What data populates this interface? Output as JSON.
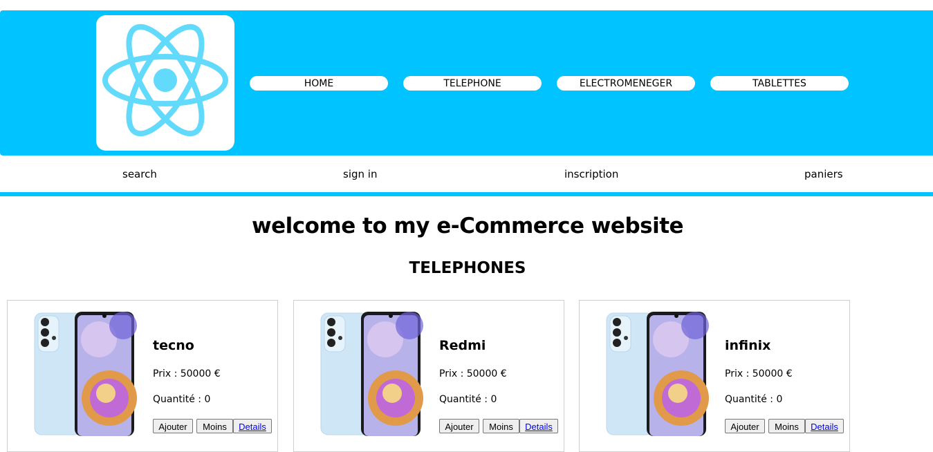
{
  "header": {
    "logo": "react-logo",
    "accent_color": "#00c3ff",
    "nav": [
      "HOME",
      "TELEPHONE",
      "ELECTROMENEGER",
      "TABLETTES"
    ]
  },
  "subnav": [
    "search",
    "sign in",
    "inscription",
    "paniers"
  ],
  "main": {
    "title": "welcome to my e-Commerce website",
    "section_title": "TELEPHONES"
  },
  "products": [
    {
      "name": "tecno",
      "price": "Prix : 50000 €",
      "quantity": "Quantité : 0",
      "add_label": "Ajouter",
      "less_label": "Moins",
      "details_label": "Details"
    },
    {
      "name": "Redmi",
      "price": "Prix : 50000 €",
      "quantity": "Quantité : 0",
      "add_label": "Ajouter",
      "less_label": "Moins",
      "details_label": "Details"
    },
    {
      "name": "infinix",
      "price": "Prix : 50000 €",
      "quantity": "Quantité : 0",
      "add_label": "Ajouter",
      "less_label": "Moins",
      "details_label": "Details"
    }
  ]
}
